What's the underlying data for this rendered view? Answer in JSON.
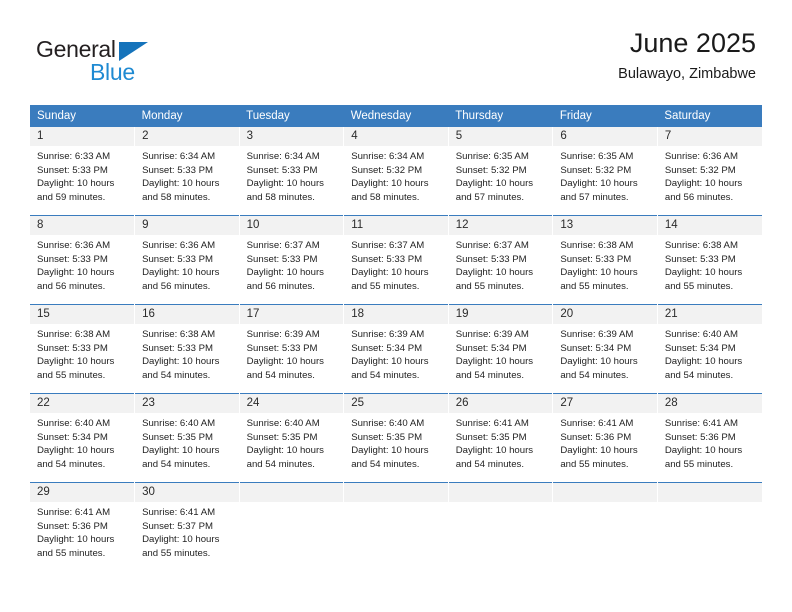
{
  "brand": {
    "name_top": "General",
    "name_bottom": "Blue",
    "triangle_icon": "triangle-logo-icon",
    "color_dark": "#231f20",
    "color_blue": "#1f8ad2"
  },
  "header": {
    "title": "June 2025",
    "subtitle": "Bulawayo, Zimbabwe"
  },
  "theme": {
    "header_bg": "#3a7cbe",
    "header_text": "#ffffff",
    "daynum_bg": "#f2f2f2",
    "cell_bg": "#ffffff"
  },
  "calendar": {
    "weekday_headers": [
      "Sunday",
      "Monday",
      "Tuesday",
      "Wednesday",
      "Thursday",
      "Friday",
      "Saturday"
    ],
    "weeks": [
      [
        {
          "day": "1",
          "sunrise": "Sunrise: 6:33 AM",
          "sunset": "Sunset: 5:33 PM",
          "daylight1": "Daylight: 10 hours",
          "daylight2": "and 59 minutes."
        },
        {
          "day": "2",
          "sunrise": "Sunrise: 6:34 AM",
          "sunset": "Sunset: 5:33 PM",
          "daylight1": "Daylight: 10 hours",
          "daylight2": "and 58 minutes."
        },
        {
          "day": "3",
          "sunrise": "Sunrise: 6:34 AM",
          "sunset": "Sunset: 5:33 PM",
          "daylight1": "Daylight: 10 hours",
          "daylight2": "and 58 minutes."
        },
        {
          "day": "4",
          "sunrise": "Sunrise: 6:34 AM",
          "sunset": "Sunset: 5:32 PM",
          "daylight1": "Daylight: 10 hours",
          "daylight2": "and 58 minutes."
        },
        {
          "day": "5",
          "sunrise": "Sunrise: 6:35 AM",
          "sunset": "Sunset: 5:32 PM",
          "daylight1": "Daylight: 10 hours",
          "daylight2": "and 57 minutes."
        },
        {
          "day": "6",
          "sunrise": "Sunrise: 6:35 AM",
          "sunset": "Sunset: 5:32 PM",
          "daylight1": "Daylight: 10 hours",
          "daylight2": "and 57 minutes."
        },
        {
          "day": "7",
          "sunrise": "Sunrise: 6:36 AM",
          "sunset": "Sunset: 5:32 PM",
          "daylight1": "Daylight: 10 hours",
          "daylight2": "and 56 minutes."
        }
      ],
      [
        {
          "day": "8",
          "sunrise": "Sunrise: 6:36 AM",
          "sunset": "Sunset: 5:33 PM",
          "daylight1": "Daylight: 10 hours",
          "daylight2": "and 56 minutes."
        },
        {
          "day": "9",
          "sunrise": "Sunrise: 6:36 AM",
          "sunset": "Sunset: 5:33 PM",
          "daylight1": "Daylight: 10 hours",
          "daylight2": "and 56 minutes."
        },
        {
          "day": "10",
          "sunrise": "Sunrise: 6:37 AM",
          "sunset": "Sunset: 5:33 PM",
          "daylight1": "Daylight: 10 hours",
          "daylight2": "and 56 minutes."
        },
        {
          "day": "11",
          "sunrise": "Sunrise: 6:37 AM",
          "sunset": "Sunset: 5:33 PM",
          "daylight1": "Daylight: 10 hours",
          "daylight2": "and 55 minutes."
        },
        {
          "day": "12",
          "sunrise": "Sunrise: 6:37 AM",
          "sunset": "Sunset: 5:33 PM",
          "daylight1": "Daylight: 10 hours",
          "daylight2": "and 55 minutes."
        },
        {
          "day": "13",
          "sunrise": "Sunrise: 6:38 AM",
          "sunset": "Sunset: 5:33 PM",
          "daylight1": "Daylight: 10 hours",
          "daylight2": "and 55 minutes."
        },
        {
          "day": "14",
          "sunrise": "Sunrise: 6:38 AM",
          "sunset": "Sunset: 5:33 PM",
          "daylight1": "Daylight: 10 hours",
          "daylight2": "and 55 minutes."
        }
      ],
      [
        {
          "day": "15",
          "sunrise": "Sunrise: 6:38 AM",
          "sunset": "Sunset: 5:33 PM",
          "daylight1": "Daylight: 10 hours",
          "daylight2": "and 55 minutes."
        },
        {
          "day": "16",
          "sunrise": "Sunrise: 6:38 AM",
          "sunset": "Sunset: 5:33 PM",
          "daylight1": "Daylight: 10 hours",
          "daylight2": "and 54 minutes."
        },
        {
          "day": "17",
          "sunrise": "Sunrise: 6:39 AM",
          "sunset": "Sunset: 5:33 PM",
          "daylight1": "Daylight: 10 hours",
          "daylight2": "and 54 minutes."
        },
        {
          "day": "18",
          "sunrise": "Sunrise: 6:39 AM",
          "sunset": "Sunset: 5:34 PM",
          "daylight1": "Daylight: 10 hours",
          "daylight2": "and 54 minutes."
        },
        {
          "day": "19",
          "sunrise": "Sunrise: 6:39 AM",
          "sunset": "Sunset: 5:34 PM",
          "daylight1": "Daylight: 10 hours",
          "daylight2": "and 54 minutes."
        },
        {
          "day": "20",
          "sunrise": "Sunrise: 6:39 AM",
          "sunset": "Sunset: 5:34 PM",
          "daylight1": "Daylight: 10 hours",
          "daylight2": "and 54 minutes."
        },
        {
          "day": "21",
          "sunrise": "Sunrise: 6:40 AM",
          "sunset": "Sunset: 5:34 PM",
          "daylight1": "Daylight: 10 hours",
          "daylight2": "and 54 minutes."
        }
      ],
      [
        {
          "day": "22",
          "sunrise": "Sunrise: 6:40 AM",
          "sunset": "Sunset: 5:34 PM",
          "daylight1": "Daylight: 10 hours",
          "daylight2": "and 54 minutes."
        },
        {
          "day": "23",
          "sunrise": "Sunrise: 6:40 AM",
          "sunset": "Sunset: 5:35 PM",
          "daylight1": "Daylight: 10 hours",
          "daylight2": "and 54 minutes."
        },
        {
          "day": "24",
          "sunrise": "Sunrise: 6:40 AM",
          "sunset": "Sunset: 5:35 PM",
          "daylight1": "Daylight: 10 hours",
          "daylight2": "and 54 minutes."
        },
        {
          "day": "25",
          "sunrise": "Sunrise: 6:40 AM",
          "sunset": "Sunset: 5:35 PM",
          "daylight1": "Daylight: 10 hours",
          "daylight2": "and 54 minutes."
        },
        {
          "day": "26",
          "sunrise": "Sunrise: 6:41 AM",
          "sunset": "Sunset: 5:35 PM",
          "daylight1": "Daylight: 10 hours",
          "daylight2": "and 54 minutes."
        },
        {
          "day": "27",
          "sunrise": "Sunrise: 6:41 AM",
          "sunset": "Sunset: 5:36 PM",
          "daylight1": "Daylight: 10 hours",
          "daylight2": "and 55 minutes."
        },
        {
          "day": "28",
          "sunrise": "Sunrise: 6:41 AM",
          "sunset": "Sunset: 5:36 PM",
          "daylight1": "Daylight: 10 hours",
          "daylight2": "and 55 minutes."
        }
      ],
      [
        {
          "day": "29",
          "sunrise": "Sunrise: 6:41 AM",
          "sunset": "Sunset: 5:36 PM",
          "daylight1": "Daylight: 10 hours",
          "daylight2": "and 55 minutes."
        },
        {
          "day": "30",
          "sunrise": "Sunrise: 6:41 AM",
          "sunset": "Sunset: 5:37 PM",
          "daylight1": "Daylight: 10 hours",
          "daylight2": "and 55 minutes."
        },
        {
          "day": "",
          "sunrise": "",
          "sunset": "",
          "daylight1": "",
          "daylight2": ""
        },
        {
          "day": "",
          "sunrise": "",
          "sunset": "",
          "daylight1": "",
          "daylight2": ""
        },
        {
          "day": "",
          "sunrise": "",
          "sunset": "",
          "daylight1": "",
          "daylight2": ""
        },
        {
          "day": "",
          "sunrise": "",
          "sunset": "",
          "daylight1": "",
          "daylight2": ""
        },
        {
          "day": "",
          "sunrise": "",
          "sunset": "",
          "daylight1": "",
          "daylight2": ""
        }
      ]
    ]
  }
}
